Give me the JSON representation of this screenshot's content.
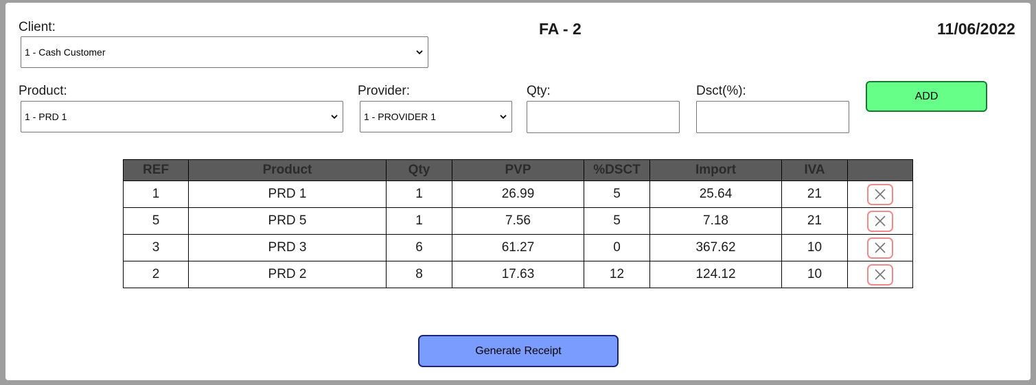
{
  "header": {
    "client_label": "Client:",
    "invoice_code": "FA - 2",
    "date": "11/06/2022"
  },
  "client_select": {
    "value": "1 - Cash Customer"
  },
  "form": {
    "product_label": "Product:",
    "product_value": "1 - PRD 1",
    "provider_label": "Provider:",
    "provider_value": "1 - PROVIDER 1",
    "qty_label": "Qty:",
    "qty_value": "",
    "dsct_label": "Dsct(%):",
    "dsct_value": "",
    "add_label": "ADD"
  },
  "table": {
    "columns": [
      "REF",
      "Product",
      "Qty",
      "PVP",
      "%DSCT",
      "Import",
      "IVA",
      ""
    ],
    "rows": [
      {
        "ref": "1",
        "product": "PRD 1",
        "qty": "1",
        "pvp": "26.99",
        "dsct": "5",
        "import": "25.64",
        "iva": "21"
      },
      {
        "ref": "5",
        "product": "PRD 5",
        "qty": "1",
        "pvp": "7.56",
        "dsct": "5",
        "import": "7.18",
        "iva": "21"
      },
      {
        "ref": "3",
        "product": "PRD 3",
        "qty": "6",
        "pvp": "61.27",
        "dsct": "0",
        "import": "367.62",
        "iva": "10"
      },
      {
        "ref": "2",
        "product": "PRD 2",
        "qty": "8",
        "pvp": "17.63",
        "dsct": "12",
        "import": "124.12",
        "iva": "10"
      }
    ]
  },
  "footer": {
    "generate_label": "Generate Receipt"
  },
  "colors": {
    "add_button": "#66ff88",
    "generate_button": "#7b9cff",
    "table_header": "#5b5b5b",
    "delete_border": "#f08a8a"
  },
  "icons": {
    "delete": "close-icon",
    "dropdown": "chevron-down-icon"
  }
}
